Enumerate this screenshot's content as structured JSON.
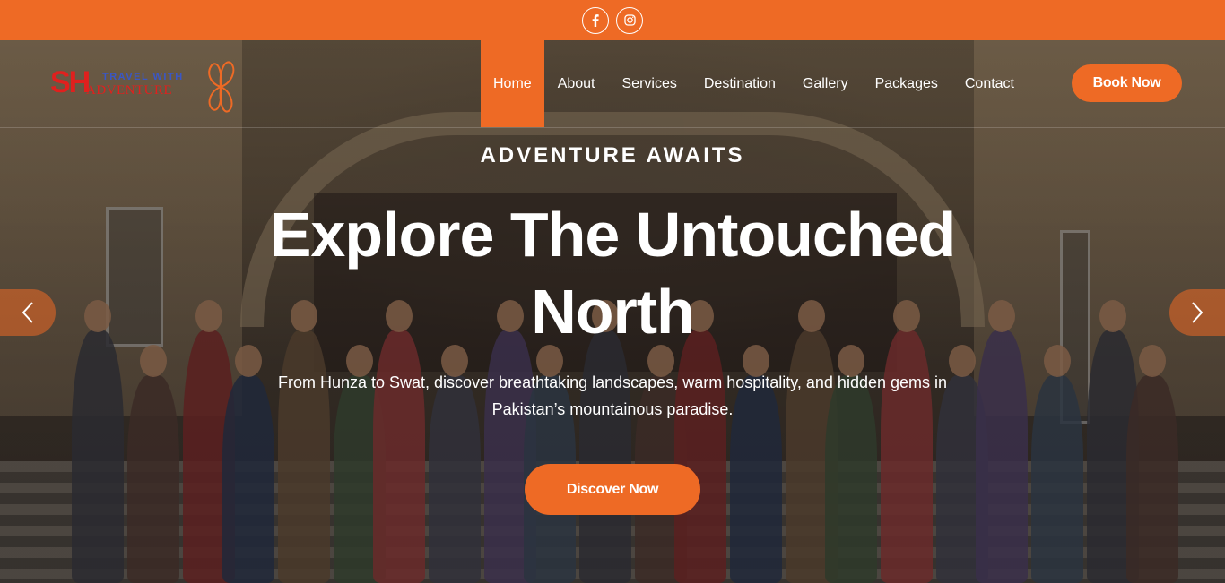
{
  "topbar": {
    "social": [
      {
        "icon": "facebook-icon"
      },
      {
        "icon": "instagram-icon"
      }
    ]
  },
  "brand": {
    "logo_sh": "SH",
    "logo_top": "TRAVEL WITH",
    "logo_bottom": "ADVENTURE"
  },
  "nav": {
    "items": [
      {
        "label": "Home",
        "active": true
      },
      {
        "label": "About"
      },
      {
        "label": "Services"
      },
      {
        "label": "Destination"
      },
      {
        "label": "Gallery"
      },
      {
        "label": "Packages"
      },
      {
        "label": "Contact"
      }
    ],
    "book_label": "Book Now"
  },
  "hero": {
    "eyebrow": "ADVENTURE AWAITS",
    "headline_line1": "Explore The Untouched",
    "headline_line2": "North",
    "lead_line1": "From Hunza to Swat, discover breathtaking landscapes, warm hospitality, and hidden gems in",
    "lead_line2": "Pakistan’s mountainous paradise.",
    "cta_label": "Discover Now"
  },
  "colors": {
    "accent": "#ee6a25",
    "logo_red": "#e0201e",
    "logo_blue": "#3a57c6"
  },
  "slider": {
    "prev_icon": "chevron-left-icon",
    "next_icon": "chevron-right-icon"
  }
}
